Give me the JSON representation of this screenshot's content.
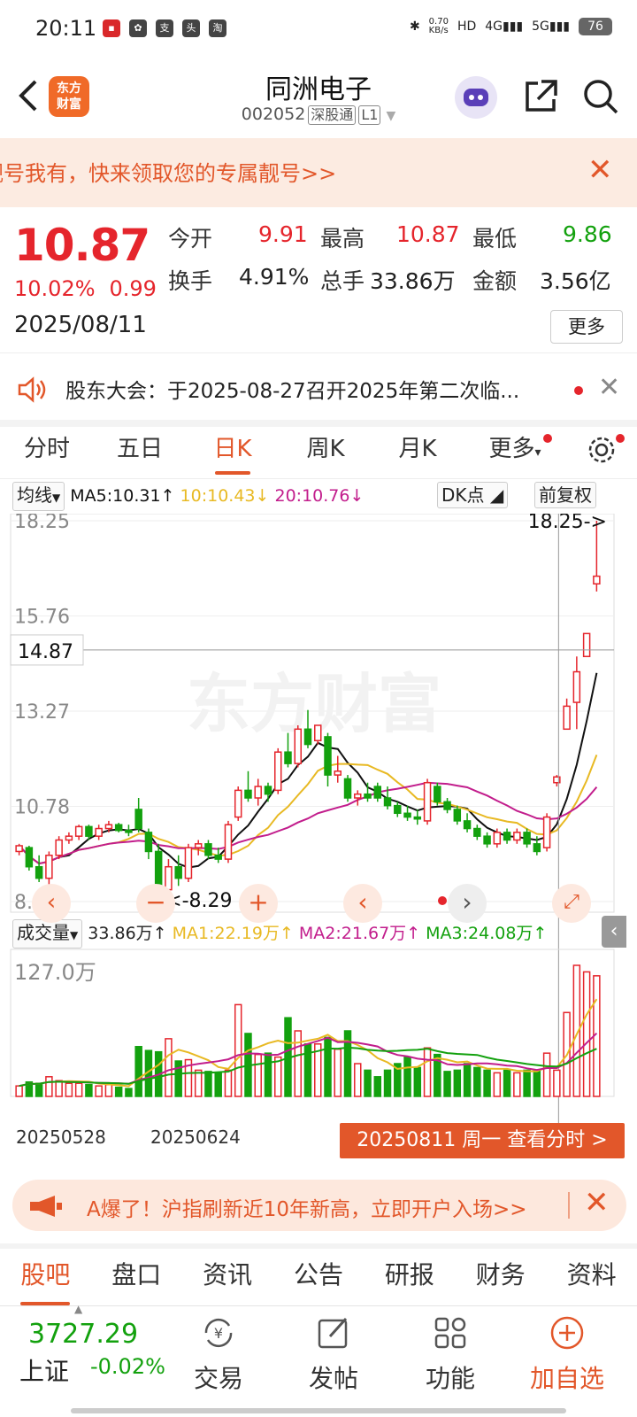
{
  "status": {
    "time": "20:11",
    "net_speed": "0.70\nKB/s",
    "battery": "76"
  },
  "header": {
    "logo": "东方\n财富",
    "title": "同洲电子",
    "code": "002052",
    "tag1": "深股通",
    "tag2": "L1"
  },
  "promo": {
    "text": "靓号我有，快来领取您的专属靓号>>"
  },
  "quote": {
    "price": "10.87",
    "pct": "10.02%",
    "change": "0.99",
    "date": "2025/08/11",
    "open_label": "今开",
    "open": "9.91",
    "high_label": "最高",
    "high": "10.87",
    "low_label": "最低",
    "low": "9.86",
    "turnover_label": "换手",
    "turnover": "4.91%",
    "volume_label": "总手",
    "volume": "33.86万",
    "amount_label": "金额",
    "amount": "3.56亿",
    "more": "更多"
  },
  "notice": {
    "text": "股东大会：于2025-08-27召开2025年第二次临..."
  },
  "tabs": [
    "分时",
    "五日",
    "日K",
    "周K",
    "月K",
    "更多"
  ],
  "active_tab": "日K",
  "ma": {
    "selector": "均线",
    "ma5": "MA5:10.31",
    "ma10": "10:10.43",
    "ma20": "20:10.76",
    "dk": "DK点",
    "adjust": "前复权"
  },
  "vol": {
    "selector": "成交量",
    "val": "33.86万",
    "ma1": "MA1:22.19万",
    "ma2": "MA2:21.67万",
    "ma3": "MA3:24.08万"
  },
  "chart_data": {
    "type": "candlestick",
    "y_ticks": [
      "18.25",
      "15.76",
      "13.27",
      "10.78",
      "8.29"
    ],
    "crosshair_price": "14.87",
    "max_label": "18.25->",
    "min_label": "<-8.29",
    "vol_max_label": "127.0万",
    "x_labels": [
      "20250528",
      "20250624"
    ],
    "selected_label": "20250811 周一 查看分时 >",
    "ohlc": [
      [
        9.6,
        9.8,
        9.5,
        9.75
      ],
      [
        9.7,
        9.75,
        9.1,
        9.2
      ],
      [
        9.2,
        9.5,
        8.8,
        8.9
      ],
      [
        8.9,
        9.6,
        8.7,
        9.5
      ],
      [
        9.5,
        10.0,
        9.4,
        9.9
      ],
      [
        9.9,
        10.1,
        9.8,
        10.0
      ],
      [
        10.0,
        10.3,
        9.9,
        10.25
      ],
      [
        10.25,
        10.3,
        9.9,
        10.0
      ],
      [
        10.0,
        10.3,
        9.9,
        10.2
      ],
      [
        10.2,
        10.4,
        10.1,
        10.3
      ],
      [
        10.3,
        10.35,
        10.1,
        10.15
      ],
      [
        10.15,
        10.3,
        10.0,
        10.1
      ],
      [
        10.7,
        11.0,
        10.1,
        10.2
      ],
      [
        10.1,
        10.2,
        9.4,
        9.6
      ],
      [
        9.6,
        9.8,
        8.3,
        8.5
      ],
      [
        8.6,
        9.4,
        8.3,
        9.2
      ],
      [
        9.2,
        9.5,
        8.7,
        8.9
      ],
      [
        8.9,
        9.8,
        8.8,
        9.7
      ],
      [
        9.7,
        9.9,
        9.5,
        9.8
      ],
      [
        9.8,
        9.9,
        9.4,
        9.5
      ],
      [
        9.5,
        9.7,
        9.3,
        9.4
      ],
      [
        9.4,
        10.4,
        9.3,
        10.3
      ],
      [
        10.5,
        11.3,
        10.4,
        11.2
      ],
      [
        11.2,
        11.7,
        10.9,
        11.0
      ],
      [
        11.0,
        11.5,
        10.8,
        11.3
      ],
      [
        11.3,
        11.4,
        10.9,
        11.1
      ],
      [
        11.2,
        12.3,
        11.1,
        12.2
      ],
      [
        12.2,
        12.7,
        11.8,
        11.9
      ],
      [
        11.9,
        12.9,
        11.8,
        12.8
      ],
      [
        12.8,
        13.3,
        12.3,
        12.4
      ],
      [
        12.5,
        12.9,
        12.4,
        12.9
      ],
      [
        12.6,
        12.7,
        11.3,
        11.6
      ],
      [
        11.6,
        12.1,
        11.4,
        11.7
      ],
      [
        11.5,
        11.6,
        10.9,
        11.0
      ],
      [
        11.0,
        11.2,
        10.8,
        11.1
      ],
      [
        11.1,
        11.4,
        10.9,
        11.0
      ],
      [
        11.3,
        11.4,
        10.9,
        11.0
      ],
      [
        11.0,
        11.3,
        10.7,
        10.8
      ],
      [
        10.8,
        10.9,
        10.5,
        10.6
      ],
      [
        10.6,
        10.8,
        10.4,
        10.5
      ],
      [
        10.5,
        10.7,
        10.3,
        10.45
      ],
      [
        10.4,
        11.5,
        10.3,
        11.4
      ],
      [
        11.3,
        11.4,
        10.8,
        10.9
      ],
      [
        10.9,
        11.0,
        10.6,
        10.7
      ],
      [
        10.7,
        10.8,
        10.3,
        10.4
      ],
      [
        10.4,
        10.6,
        10.1,
        10.2
      ],
      [
        10.2,
        10.3,
        9.9,
        10.0
      ],
      [
        10.0,
        10.1,
        9.7,
        9.8
      ],
      [
        9.8,
        10.2,
        9.7,
        10.1
      ],
      [
        10.1,
        10.2,
        9.8,
        9.9
      ],
      [
        9.9,
        10.2,
        9.8,
        10.1
      ],
      [
        10.1,
        10.2,
        9.7,
        9.8
      ],
      [
        9.8,
        10.0,
        9.5,
        9.6
      ],
      [
        9.7,
        10.6,
        9.6,
        10.5
      ],
      [
        11.4,
        11.6,
        11.3,
        11.55
      ],
      [
        12.8,
        13.6,
        12.8,
        13.4
      ],
      [
        13.5,
        14.7,
        12.8,
        14.3
      ],
      [
        14.7,
        15.3,
        14.7,
        15.3
      ],
      [
        16.6,
        18.25,
        16.4,
        16.8
      ]
    ],
    "volume": [
      0.08,
      0.11,
      0.1,
      0.15,
      0.12,
      0.1,
      0.1,
      0.09,
      0.08,
      0.09,
      0.07,
      0.06,
      0.38,
      0.35,
      0.34,
      0.44,
      0.27,
      0.28,
      0.2,
      0.19,
      0.18,
      0.2,
      0.7,
      0.48,
      0.32,
      0.33,
      0.3,
      0.6,
      0.5,
      0.4,
      0.4,
      0.45,
      0.36,
      0.5,
      0.25,
      0.2,
      0.15,
      0.2,
      0.25,
      0.3,
      0.22,
      0.37,
      0.32,
      0.19,
      0.2,
      0.25,
      0.22,
      0.2,
      0.18,
      0.2,
      0.18,
      0.2,
      0.2,
      0.33,
      0.2,
      0.64,
      1.0,
      0.95,
      0.92
    ]
  },
  "promo2": {
    "text": "A爆了！沪指刷新近10年新高，立即开户入场>>"
  },
  "sections": [
    "股吧",
    "盘口",
    "资讯",
    "公告",
    "研报",
    "财务",
    "资料"
  ],
  "active_section": "股吧",
  "bottom": {
    "index_value": "3727.29",
    "index_name": "上证",
    "index_change": "-0.02%",
    "trade": "交易",
    "post": "发帖",
    "func": "功能",
    "add": "加自选"
  },
  "colors": {
    "up": "#e5252c",
    "down": "#13a10e",
    "accent": "#e2572a"
  }
}
